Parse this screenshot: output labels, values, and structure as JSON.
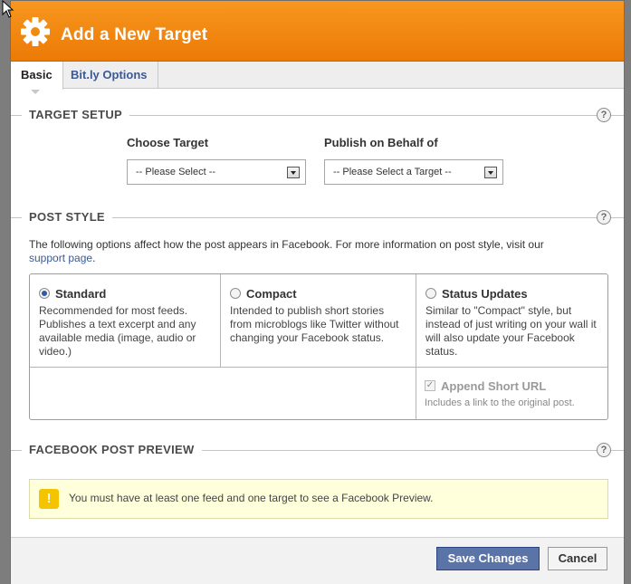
{
  "dialog": {
    "title": "Add a New Target",
    "icon": "gear-icon",
    "accent_color": "#f08a11"
  },
  "tabs": [
    {
      "label": "Basic",
      "active": true
    },
    {
      "label": "Bit.ly Options",
      "active": false
    }
  ],
  "target_setup": {
    "heading": "TARGET SETUP",
    "help": "?",
    "choose_target": {
      "label": "Choose Target",
      "value": "-- Please Select --"
    },
    "publish_behalf": {
      "label": "Publish on Behalf of",
      "value": "-- Please Select a Target --"
    }
  },
  "post_style": {
    "heading": "POST STYLE",
    "help": "?",
    "intro_text": "The following options affect how the post appears in Facebook. For more information on post style, visit our",
    "intro_link": "support page",
    "intro_end": ".",
    "options": [
      {
        "name": "Standard",
        "selected": true,
        "desc": "Recommended for most feeds. Publishes a text excerpt and any available media (image, audio or video.)"
      },
      {
        "name": "Compact",
        "selected": false,
        "desc": "Intended to publish short stories from microblogs like Twitter without changing your Facebook status."
      },
      {
        "name": "Status Updates",
        "selected": false,
        "desc": "Similar to \"Compact\" style, but instead of just writing on your wall it will also update your Facebook status."
      }
    ],
    "short_url": {
      "label": "Append Short URL",
      "checked": true,
      "disabled": true,
      "desc": "Includes a link to the original post."
    }
  },
  "preview": {
    "heading": "FACEBOOK POST PREVIEW",
    "help": "?",
    "notice": "You must have at least one feed and one target to see a Facebook Preview.",
    "notice_icon": "!"
  },
  "footer": {
    "save_label": "Save Changes",
    "cancel_label": "Cancel"
  }
}
